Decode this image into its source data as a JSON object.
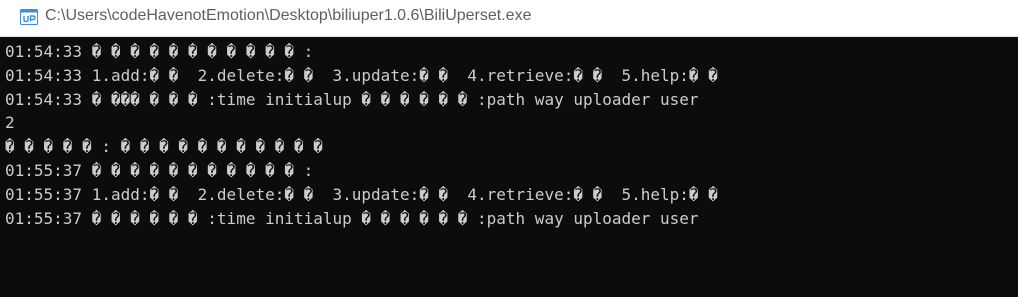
{
  "window": {
    "title": "C:\\Users\\codeHavenotEmotion\\Desktop\\biliuper1.0.6\\BiliUperset.exe",
    "icon": "console-app-icon",
    "background_color": "#0c0c0c",
    "text_color": "#cccccc"
  },
  "console": {
    "lines": [
      "01:54:33 � � � � � � � � � � � :",
      "01:54:33 1.add:� �  2.delete:� �  3.update:� �  4.retrieve:� �  5.help:� �",
      "01:54:33 � ��� � � � :time initialup � � � � � � :path way uploader user",
      "2",
      "� � � � � : � � � � � � � � � � �",
      "01:55:37 � � � � � � � � � � � :",
      "01:55:37 1.add:� �  2.delete:� �  3.update:� �  4.retrieve:� �  5.help:� �",
      "01:55:37 � � � � � � :time initialup � � � � � � :path way uploader user"
    ]
  }
}
